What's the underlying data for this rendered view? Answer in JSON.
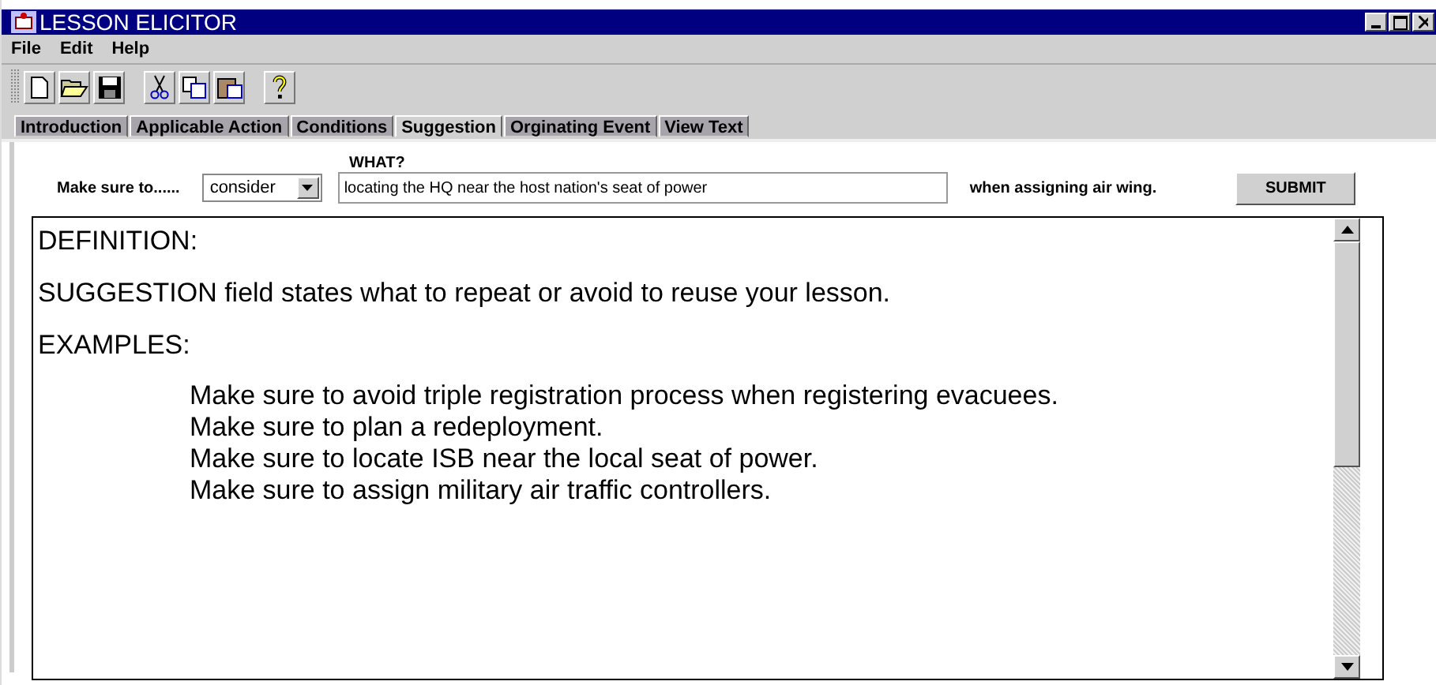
{
  "window": {
    "title": "LESSON ELICITOR"
  },
  "menu": [
    "File",
    "Edit",
    "Help"
  ],
  "tabs": [
    {
      "label": "Introduction",
      "selected": false
    },
    {
      "label": "Applicable Action",
      "selected": false
    },
    {
      "label": "Conditions",
      "selected": false
    },
    {
      "label": "Suggestion",
      "selected": true
    },
    {
      "label": "Orginating Event",
      "selected": false
    },
    {
      "label": "View Text",
      "selected": false
    }
  ],
  "form": {
    "prefix_label": "Make sure to......",
    "verb": "consider",
    "what_label": "WHAT?",
    "what_value": "locating the HQ near the host nation's seat of power",
    "suffix_label": "when assigning air wing.",
    "submit": "SUBMIT"
  },
  "text_area": {
    "definition_heading": "DEFINITION:",
    "definition": "SUGGESTION field states what to repeat or avoid to reuse your lesson.",
    "examples_heading": "EXAMPLES:",
    "examples": [
      "Make sure to avoid triple registration process when registering evacuees.",
      "Make sure to plan a redeployment.",
      "Make sure to locate ISB near the local seat of power.",
      "Make sure to assign military air traffic controllers."
    ]
  }
}
